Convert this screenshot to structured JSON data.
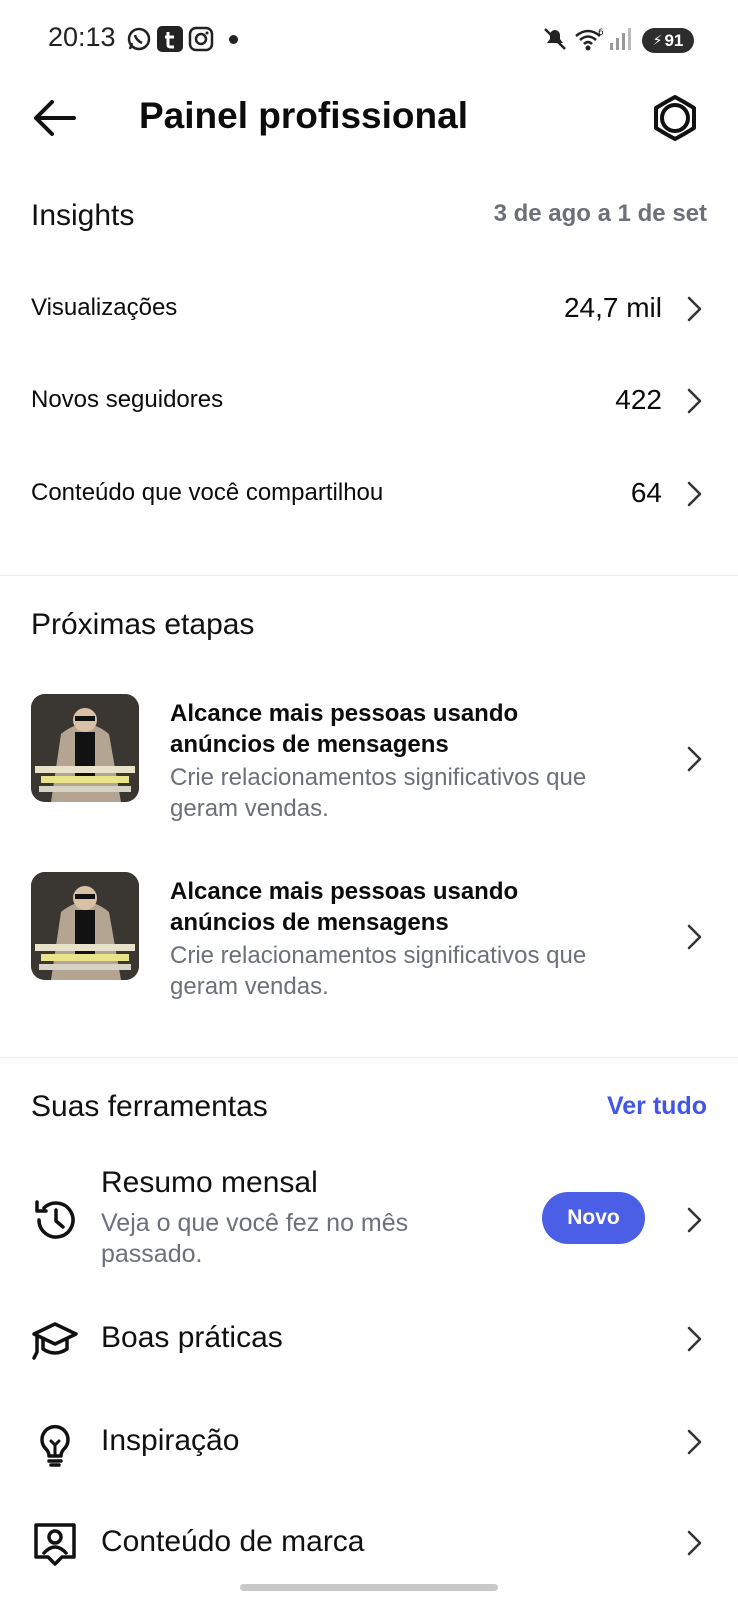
{
  "status_bar": {
    "time": "20:13",
    "battery": "91",
    "icons": [
      "whatsapp-icon",
      "tumblr-icon",
      "instagram-icon",
      "dot-icon",
      "mute-icon",
      "wifi-icon",
      "signal-icon",
      "battery-icon"
    ]
  },
  "header": {
    "title": "Painel profissional",
    "back_icon": "arrow-left-icon",
    "settings_icon": "gear-icon"
  },
  "insights": {
    "title": "Insights",
    "date_range": "3 de ago a 1 de set",
    "metrics": [
      {
        "label": "Visualizações",
        "value": "24,7 mil"
      },
      {
        "label": "Novos seguidores",
        "value": "422"
      },
      {
        "label": "Conteúdo que você compartilhou",
        "value": "64"
      }
    ]
  },
  "next_steps": {
    "title": "Próximas etapas",
    "items": [
      {
        "title": "Alcance mais pessoas usando anúncios de mensagens",
        "description": "Crie relacionamentos significativos que geram vendas."
      },
      {
        "title": "Alcance mais pessoas usando anúncios de mensagens",
        "description": "Crie relacionamentos significativos que geram vendas."
      }
    ]
  },
  "tools": {
    "title": "Suas ferramentas",
    "see_all": "Ver tudo",
    "items": [
      {
        "label": "Resumo mensal",
        "description": "Veja o que você fez no mês passado.",
        "badge": "Novo",
        "icon": "history-icon"
      },
      {
        "label": "Boas práticas",
        "icon": "graduation-cap-icon"
      },
      {
        "label": "Inspiração",
        "icon": "lightbulb-icon"
      },
      {
        "label": "Conteúdo de marca",
        "icon": "branded-content-icon"
      }
    ]
  },
  "colors": {
    "accent": "#4255e8",
    "badge": "#4a5ee6",
    "muted_text": "#6b7079"
  }
}
